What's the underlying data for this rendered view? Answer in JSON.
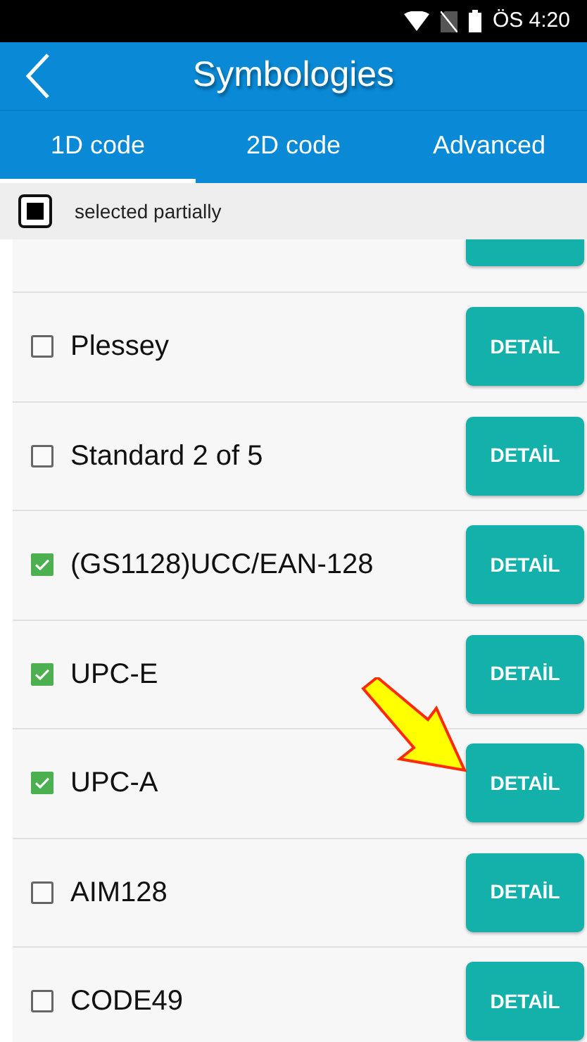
{
  "status_bar": {
    "time": "ÖS 4:20"
  },
  "title": "Symbologies",
  "tabs": [
    {
      "label": "1D code",
      "selected": true
    },
    {
      "label": "2D code",
      "selected": false
    },
    {
      "label": "Advanced",
      "selected": false
    }
  ],
  "select_all": {
    "label": "selected partially",
    "partial": true
  },
  "items": [
    {
      "name": "Plessey",
      "checked": false,
      "button": "DETAİL"
    },
    {
      "name": "Standard 2 of 5",
      "checked": false,
      "button": "DETAİL"
    },
    {
      "name": "(GS1128)UCC/EAN-128",
      "checked": true,
      "button": "DETAİL"
    },
    {
      "name": "UPC-E",
      "checked": true,
      "button": "DETAİL"
    },
    {
      "name": "UPC-A",
      "checked": true,
      "button": "DETAİL"
    },
    {
      "name": "AIM128",
      "checked": false,
      "button": "DETAİL"
    },
    {
      "name": "CODE49",
      "checked": false,
      "button": "DETAİL"
    }
  ]
}
